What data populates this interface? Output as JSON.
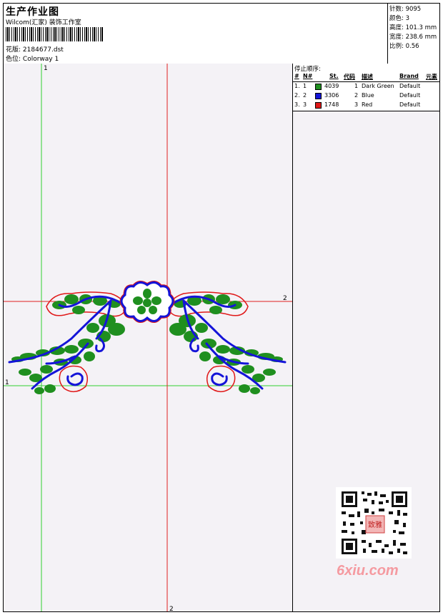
{
  "header": {
    "title": "生产作业图",
    "subtitle": "Wilcom(汇家) 装饰工作室",
    "design_label": "花版:",
    "design_value": "2184677.dst",
    "colorway_label": "色位:",
    "colorway_value": "Colorway 1"
  },
  "stats": [
    {
      "label": "针数:",
      "value": "9095"
    },
    {
      "label": "颜色:",
      "value": "3"
    },
    {
      "label": "高度:",
      "value": "101.3 mm"
    },
    {
      "label": "宽度:",
      "value": "238.6 mm"
    },
    {
      "label": "比例:",
      "value": "0.56"
    }
  ],
  "guides": {
    "green_top": "1",
    "green_left": "1",
    "red_right": "2",
    "red_bottom": "2"
  },
  "stop_sequence": {
    "title": "停止顺序:",
    "columns": [
      "#",
      "N#",
      "St.",
      "代码",
      "描述",
      "Brand",
      "元素"
    ],
    "rows": [
      {
        "no": "1.",
        "n": "1",
        "color": "#1f8f1f",
        "st": "4039",
        "code": "1",
        "desc": "Dark Green",
        "brand": "Default"
      },
      {
        "no": "2.",
        "n": "2",
        "color": "#1414d8",
        "st": "3306",
        "code": "2",
        "desc": "Blue",
        "brand": "Default"
      },
      {
        "no": "3.",
        "n": "3",
        "color": "#e01818",
        "st": "1748",
        "code": "3",
        "desc": "Red",
        "brand": "Default"
      }
    ]
  },
  "watermark": {
    "text": "6xiu.com",
    "seal_text": "致雅"
  },
  "colors": {
    "green": "#1f8f1f",
    "blue": "#1414d8",
    "red": "#e01818",
    "guide_green": "#30d030",
    "guide_red": "#e02020"
  }
}
